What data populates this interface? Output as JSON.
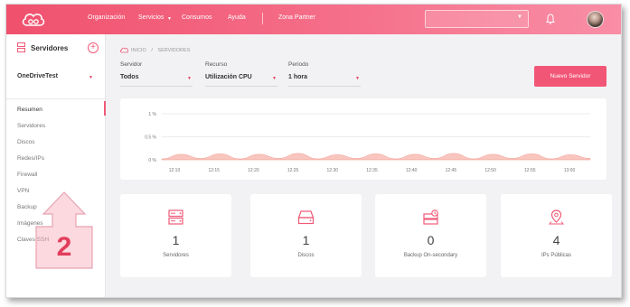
{
  "header": {
    "nav": [
      "Organización",
      "Servicios",
      "Consumos",
      "Ayuda",
      "Zona Partner"
    ]
  },
  "sidebar": {
    "title": "Servidores",
    "add_label": "+",
    "selected_account": "OneDriveTest",
    "items": [
      {
        "label": "Resumen",
        "active": true
      },
      {
        "label": "Servidores"
      },
      {
        "label": "Discos"
      },
      {
        "label": "Redes/IPs"
      },
      {
        "label": "Firewall"
      },
      {
        "label": "VPN"
      },
      {
        "label": "Backup"
      },
      {
        "label": "Imágenes"
      },
      {
        "label": "Claves SSH"
      }
    ]
  },
  "breadcrumb": {
    "home": "INICIO",
    "sep": "/",
    "current": "SERVIDORES"
  },
  "filters": {
    "server": {
      "label": "Servidor",
      "value": "Todos"
    },
    "resource": {
      "label": "Recurso",
      "value": "Utilización CPU"
    },
    "period": {
      "label": "Periodo",
      "value": "1 hora"
    }
  },
  "new_server_button": "Nuevo Servidor",
  "chart_data": {
    "type": "area",
    "y_ticks": [
      "1 %",
      "0.5 %",
      "0 %"
    ],
    "ylim": [
      0,
      1
    ],
    "x": [
      "12:10",
      "12:15",
      "12:20",
      "12:25",
      "12:30",
      "12:35",
      "12:40",
      "12:45",
      "12:50",
      "12:55",
      "13:00"
    ],
    "series": [
      {
        "values": [
          0.02,
          0.12,
          0.03,
          0.13,
          0.02,
          0.12,
          0.03,
          0.14,
          0.02,
          0.11,
          0.03,
          0.13,
          0.02,
          0.12,
          0.03,
          0.14,
          0.02,
          0.12,
          0.03,
          0.13,
          0.02,
          0.11,
          0.03
        ]
      }
    ],
    "grid": true,
    "color": "#f7b3a9"
  },
  "stats": [
    {
      "value": "1",
      "label": "Servidores",
      "icon": "server-icon"
    },
    {
      "value": "1",
      "label": "Discos",
      "icon": "disk-icon"
    },
    {
      "value": "0",
      "label": "Backup On-secondary",
      "icon": "backup-icon"
    },
    {
      "value": "4",
      "label": "IPs Públicas",
      "icon": "location-pin-icon"
    }
  ],
  "annotation": {
    "number": "2"
  },
  "colors": {
    "accent": "#f25676",
    "brand_gradient_start": "#f0516d",
    "brand_gradient_end": "#f98ea6"
  }
}
